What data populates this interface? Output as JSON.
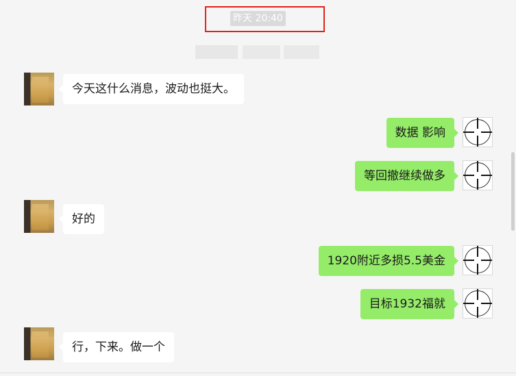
{
  "timestamp": "昨天 20:40",
  "colors": {
    "background": "#f5f5f5",
    "incoming_bubble": "#ffffff",
    "outgoing_bubble": "#95ec69",
    "highlight_box": "#e3201b"
  },
  "messages": [
    {
      "direction": "in",
      "text": "今天这什么消息，波动也挺大。"
    },
    {
      "direction": "out",
      "text": "数据 影响"
    },
    {
      "direction": "out",
      "text": "等回撤继续做多"
    },
    {
      "direction": "in",
      "text": "好的"
    },
    {
      "direction": "out",
      "text": "1920附近多损5.5美金"
    },
    {
      "direction": "out",
      "text": "目标1932福就"
    },
    {
      "direction": "in",
      "text": "行，下来。做一个"
    }
  ],
  "icons": {
    "incoming_avatar": "blurred-avatar-icon",
    "outgoing_avatar": "crosshair-avatar-icon"
  }
}
